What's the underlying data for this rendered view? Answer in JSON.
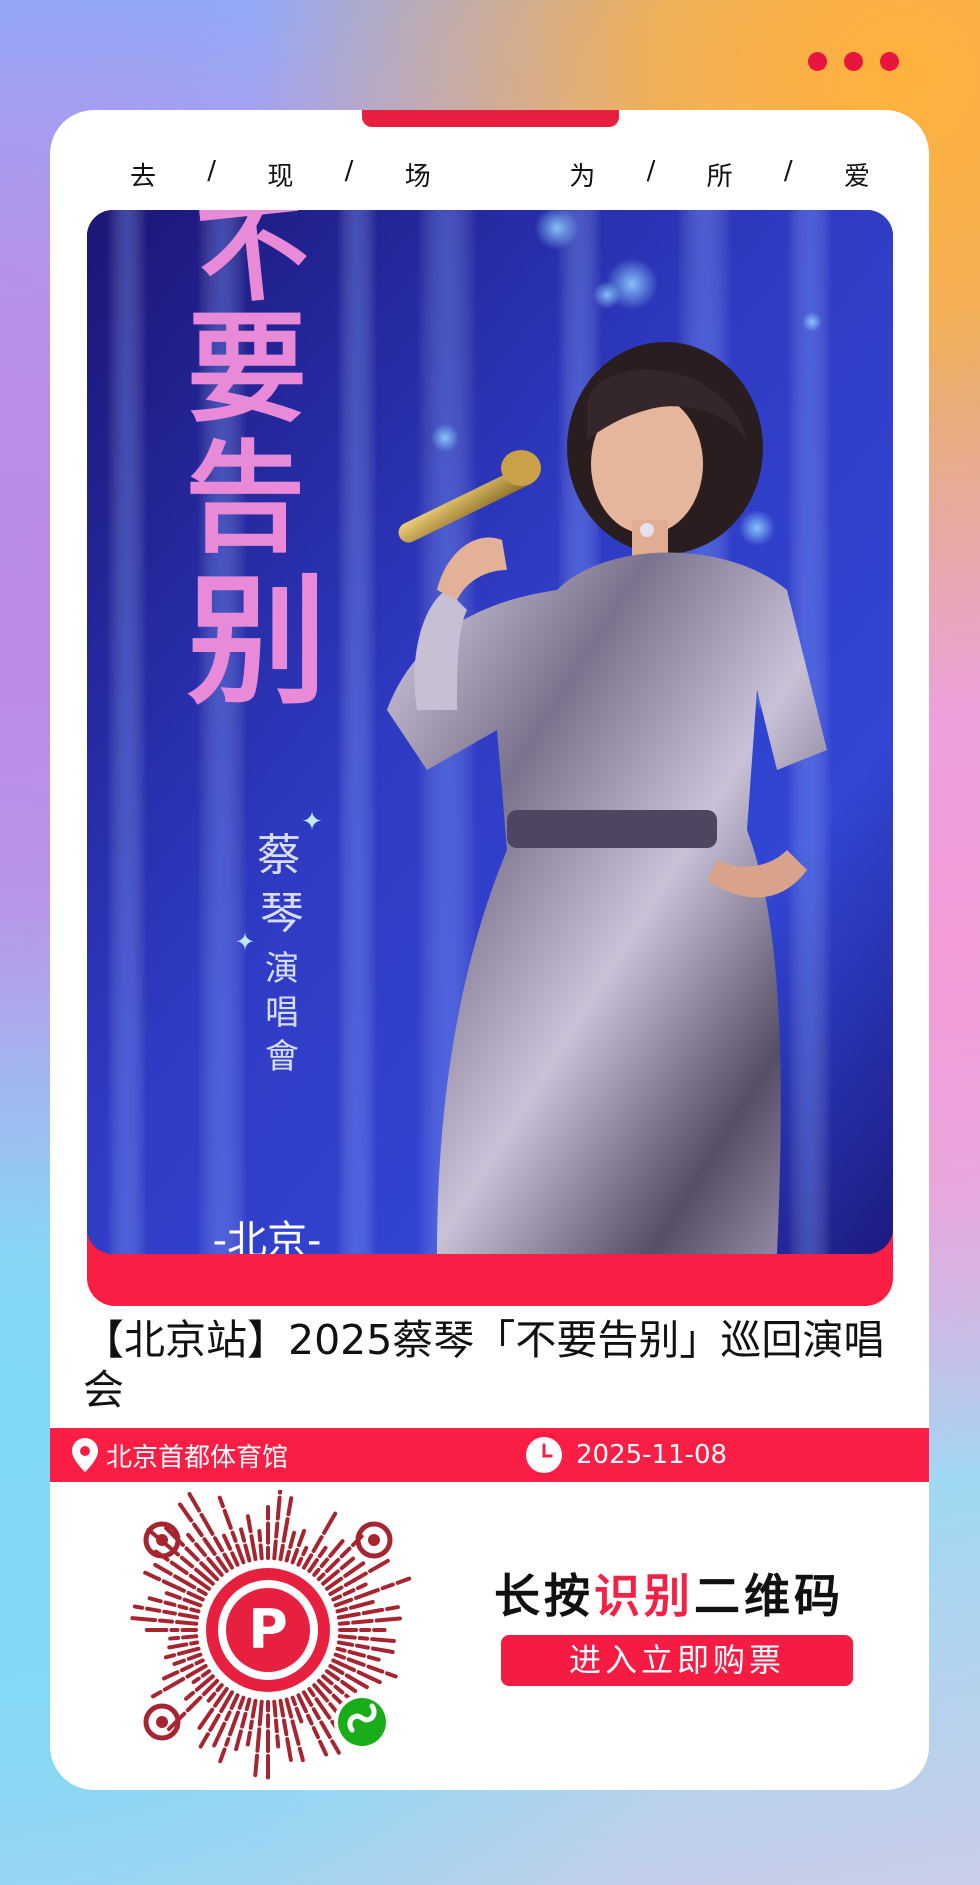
{
  "slogan": [
    "去",
    "/",
    "现",
    "/",
    "场",
    "为",
    "/",
    "所",
    "/",
    "爱"
  ],
  "poster": {
    "title": "不要告别",
    "artist": "蔡琴演唱會",
    "city": "北京"
  },
  "event": {
    "title": "【北京站】2025蔡琴「不要告别」巡回演唱会",
    "venue": "北京首都体育馆",
    "date": "2025-11-08"
  },
  "cta": {
    "prefix": "长按",
    "highlight": "识别",
    "suffix": "二维码",
    "button_label": "进入立即购票"
  },
  "qr": {
    "logo_letter": "P"
  },
  "colors": {
    "accent": "#fa1d44",
    "title_pink": "#e98ad8",
    "mini_program_green": "#1aad19"
  },
  "icons": [
    "more-dots-icon",
    "location-pin-icon",
    "clock-icon",
    "mini-program-icon"
  ]
}
